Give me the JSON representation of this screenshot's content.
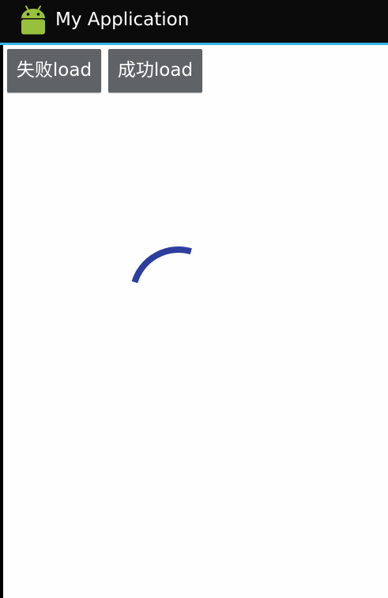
{
  "action_bar": {
    "title": "My Application",
    "icon": "android-robot-icon"
  },
  "buttons": {
    "fail_label": "失败load",
    "success_label": "成功load"
  },
  "spinner": {
    "icon": "progress-spinner-icon"
  },
  "colors": {
    "action_bar_bg": "#0b0b0b",
    "divider": "#33b5e5",
    "content_bg": "#fefefe",
    "button_bg": "#5f6365",
    "spinner": "#2d3e9e",
    "android_green": "#97c03d"
  }
}
